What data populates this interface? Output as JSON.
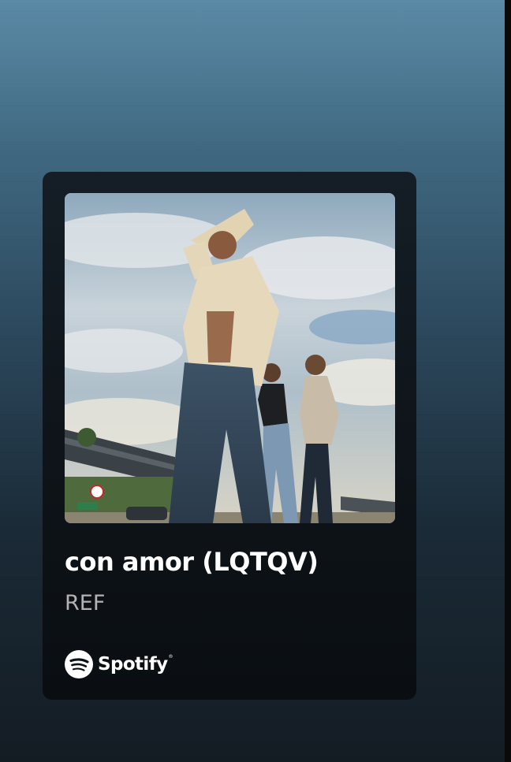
{
  "track": {
    "title": "con amor (LQTQV)",
    "artist": "REF"
  },
  "branding": {
    "name": "Spotify",
    "icon": "spotify-logo-icon"
  },
  "cover_art": {
    "description_icon": "album-cover-image"
  },
  "colors": {
    "card_background": "#0f151b",
    "title_text": "#ffffff",
    "artist_text": "#b3b3b3",
    "page_gradient_top": "#5b8aa6",
    "page_gradient_bottom": "#141c23"
  }
}
